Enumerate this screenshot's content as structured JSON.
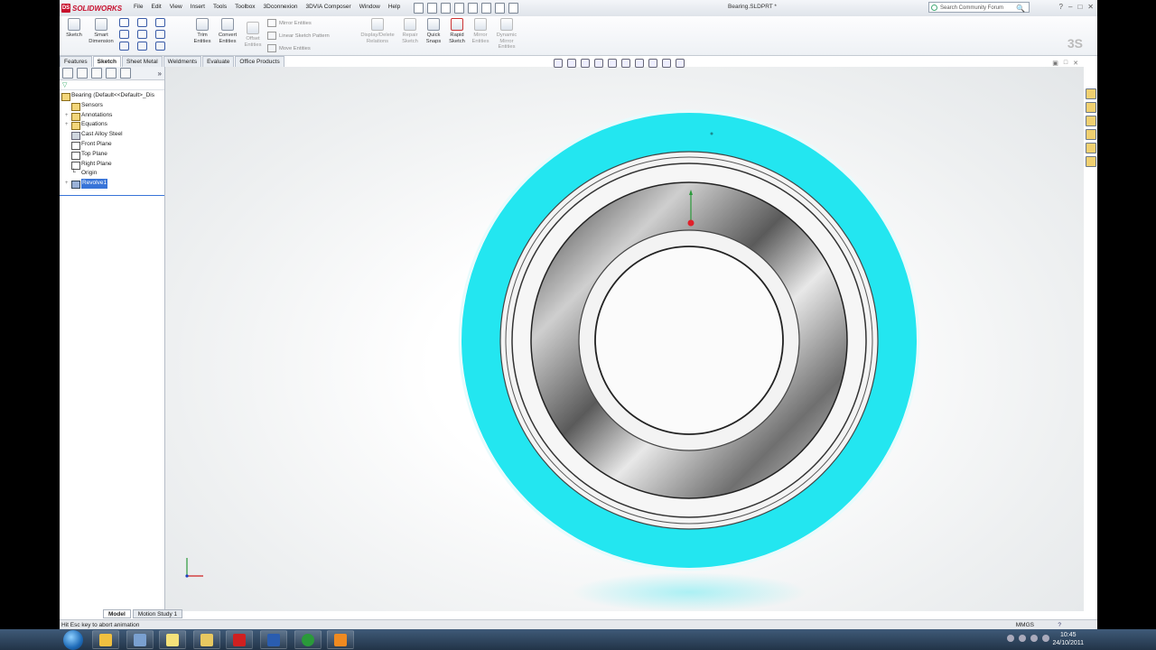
{
  "app": {
    "brand": "SOLIDWORKS",
    "document_title": "Bearing.SLDPRT *",
    "menu": [
      "File",
      "Edit",
      "View",
      "Insert",
      "Tools",
      "Toolbox",
      "3Dconnexion",
      "3DVIA Composer",
      "Window",
      "Help"
    ]
  },
  "search": {
    "placeholder": "Search Community Forum"
  },
  "commandbar": {
    "sketch": "Sketch",
    "smart_dimension": [
      "Smart",
      "Dimension"
    ],
    "trim_entities": [
      "Trim",
      "Entities"
    ],
    "convert_entities": [
      "Convert",
      "Entities"
    ],
    "offset_entities": [
      "Offset",
      "Entities"
    ],
    "mirror_entities": "Mirror Entities",
    "linear_sketch_pattern": "Linear Sketch Pattern",
    "move_entities": "Move Entities",
    "display_delete_relations": [
      "Display/Delete",
      "Relations"
    ],
    "repair_sketch": [
      "Repair",
      "Sketch"
    ],
    "quick_snaps": [
      "Quick",
      "Snaps"
    ],
    "rapid_sketch": [
      "Rapid",
      "Sketch"
    ],
    "mirror_entities2": [
      "Mirror",
      "Entities"
    ],
    "dynamic_mirror": [
      "Dynamic",
      "Mirror",
      "Entities"
    ]
  },
  "tabs": [
    "Features",
    "Sketch",
    "Sheet Metal",
    "Weldments",
    "Evaluate",
    "Office Products"
  ],
  "active_tab": "Sketch",
  "tree": {
    "root": "Bearing  (Default<<Default>_Dis",
    "items": [
      "Sensors",
      "Annotations",
      "Equations",
      "Cast Alloy Steel",
      "Front Plane",
      "Top Plane",
      "Right Plane",
      "Origin",
      "Revolve1"
    ]
  },
  "bottom_tabs": [
    "Model",
    "Motion Study 1"
  ],
  "status": {
    "message": "Hit Esc key to abort animation",
    "units": "MMGS",
    "help": "?"
  },
  "taskbar": {
    "time": "10:45",
    "date": "24/10/2011"
  },
  "colors": {
    "highlight": "#23e6f0",
    "selection": "#3874d8"
  }
}
